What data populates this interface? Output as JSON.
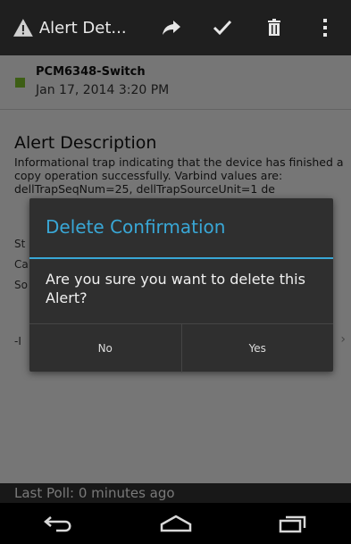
{
  "actionbar": {
    "title": "Alert Det...",
    "icons": [
      "warning-logo-icon",
      "share-icon",
      "check-icon",
      "trash-icon",
      "overflow-menu-icon"
    ]
  },
  "alert": {
    "hostname": "PCM6348-Switch",
    "timestamp": "Jan 17, 2014 3:20 PM",
    "checked": true,
    "check_color": "#7bbd2a"
  },
  "description": {
    "title": "Alert Description",
    "body": "Informational trap indicating that the device has finished a copy operation successfully. Varbind values are: dellTrapSeqNum=25, dellTrapSourceUnit=1 de",
    "fragments": [
      "St",
      "Ca",
      "So",
      "-I"
    ]
  },
  "dialog": {
    "title": "Delete Confirmation",
    "message": "Are you sure you want to delete this Alert?",
    "no_label": "No",
    "yes_label": "Yes",
    "accent": "#39a7d6"
  },
  "status": {
    "text": "Last Poll: 0 minutes ago"
  },
  "navbar": {
    "icons": [
      "back-icon",
      "home-icon",
      "recents-icon"
    ]
  }
}
